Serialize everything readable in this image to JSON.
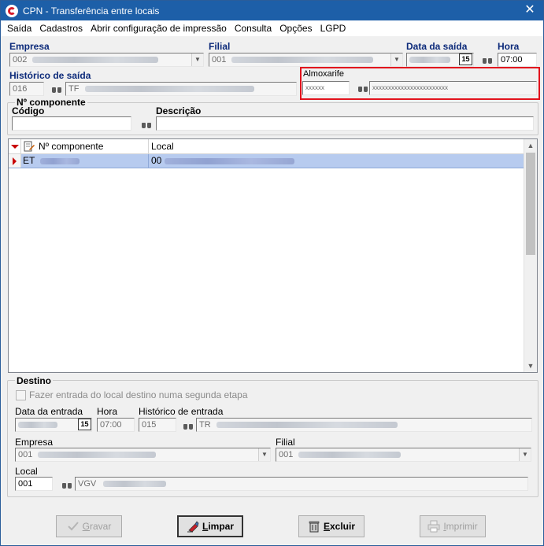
{
  "window": {
    "title": "CPN - Transferência entre locais",
    "close": "✕"
  },
  "menu": [
    "Saída",
    "Cadastros",
    "Abrir configuração de impressão",
    "Consulta",
    "Opções",
    "LGPD"
  ],
  "header": {
    "empresa_label": "Empresa",
    "empresa_value": "002",
    "filial_label": "Filial",
    "filial_value": "001",
    "data_saida_label": "Data da saída",
    "hora_label": "Hora",
    "hora_value": "07:00",
    "historico_label": "Histórico de saída",
    "historico_code": "016",
    "historico_desc": "TF",
    "almox_label": "Almoxarife",
    "almox_code": "xxxxxx",
    "almox_name": "xxxxxxxxxxxxxxxxxxxxxxxx",
    "calendar_label": "15"
  },
  "componente": {
    "group_label": "Nº componente",
    "codigo_label": "Código",
    "descricao_label": "Descrição"
  },
  "grid": {
    "col_componente": "Nº componente",
    "col_local": "Local",
    "rows": [
      {
        "componente": "ET",
        "local": "00"
      }
    ]
  },
  "destino": {
    "group_label": "Destino",
    "checkbox_label": "Fazer entrada do local destino numa segunda etapa",
    "data_entrada_label": "Data da entrada",
    "hora_label": "Hora",
    "hora_value": "07:00",
    "historico_label": "Histórico de entrada",
    "historico_code": "015",
    "historico_desc": "TR",
    "empresa_label": "Empresa",
    "empresa_value": "001",
    "filial_label": "Filial",
    "filial_value": "001",
    "local_label": "Local",
    "local_code": "001",
    "local_desc": "VGV",
    "calendar_label": "15"
  },
  "buttons": {
    "gravar": "Gravar",
    "limpar": "Limpar",
    "excluir": "Excluir",
    "imprimir": "Imprimir"
  },
  "colors": {
    "title_bar": "#1d5fa8",
    "label_blue": "#0c2a7a",
    "highlight_red": "#e2131d",
    "selected_row": "#b7cbef"
  }
}
